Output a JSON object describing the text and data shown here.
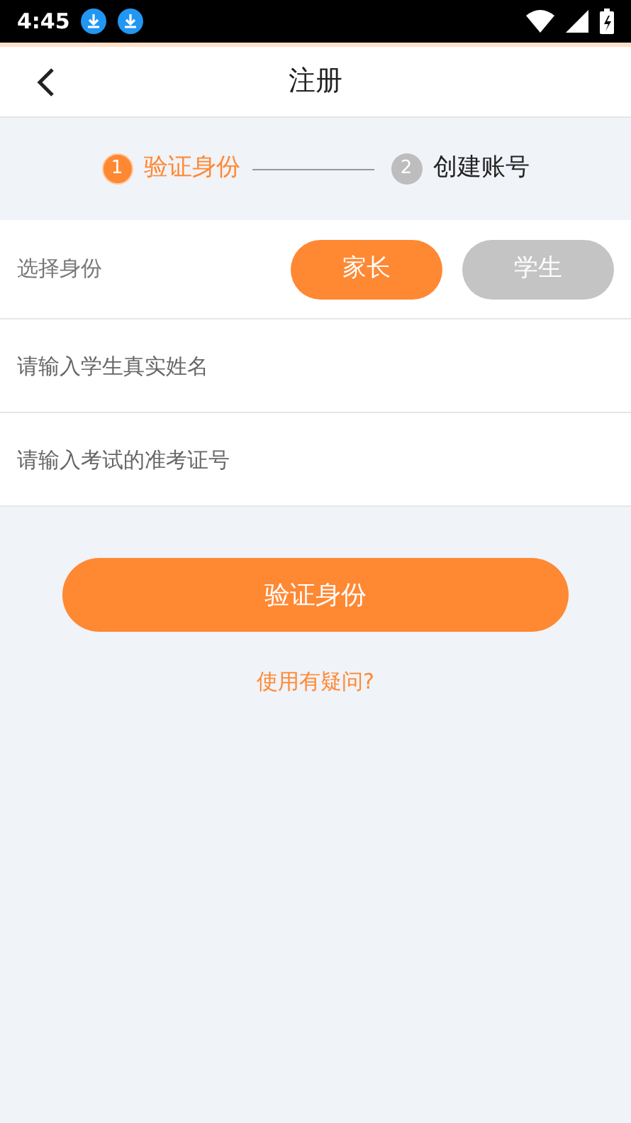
{
  "status_bar": {
    "time": "4:45"
  },
  "header": {
    "title": "注册"
  },
  "steps": [
    {
      "number": "1",
      "label": "验证身份",
      "selected": true
    },
    {
      "number": "2",
      "label": "创建账号",
      "selected": false
    }
  ],
  "identity": {
    "label": "选择身份",
    "options": [
      {
        "label": "家长",
        "selected": true
      },
      {
        "label": "学生",
        "selected": false
      }
    ]
  },
  "fields": [
    {
      "placeholder": "请输入学生真实姓名"
    },
    {
      "placeholder": "请输入考试的准考证号"
    }
  ],
  "submit_button": "验证身份",
  "help_link": "使用有疑问?"
}
